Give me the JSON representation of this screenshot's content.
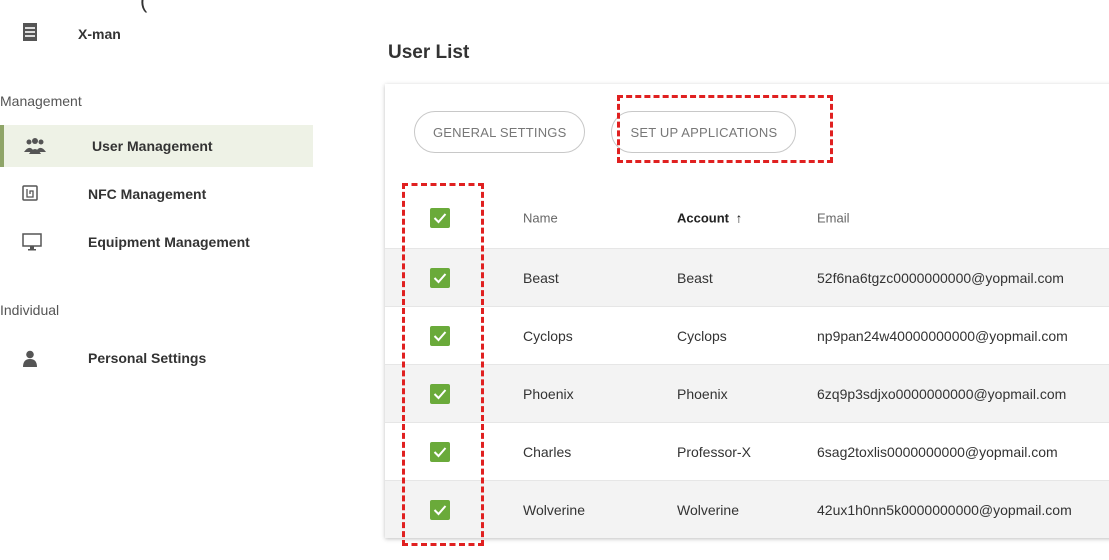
{
  "top_crop_text": "(",
  "sidebar": {
    "brand": "X-man",
    "sections": [
      {
        "title": "Management"
      },
      {
        "title": "Individual"
      }
    ],
    "items": [
      {
        "label": "User Management",
        "icon": "users-icon"
      },
      {
        "label": "NFC Management",
        "icon": "nfc-icon"
      },
      {
        "label": "Equipment Management",
        "icon": "monitor-icon"
      },
      {
        "label": "Personal Settings",
        "icon": "person-icon"
      }
    ]
  },
  "main": {
    "title": "User List",
    "tabs": [
      {
        "label": "GENERAL SETTINGS"
      },
      {
        "label": "SET UP APPLICATIONS"
      }
    ],
    "table": {
      "headers": {
        "name": "Name",
        "account": "Account",
        "email": "Email",
        "sort_arrow": "↑"
      },
      "rows": [
        {
          "name": "Beast",
          "account": "Beast",
          "email": "52f6na6tgzc0000000000@yopmail.com"
        },
        {
          "name": "Cyclops",
          "account": "Cyclops",
          "email": "np9pan24w40000000000@yopmail.com"
        },
        {
          "name": "Phoenix",
          "account": "Phoenix",
          "email": "6zq9p3sdjxo0000000000@yopmail.com"
        },
        {
          "name": "Charles",
          "account": "Professor-X",
          "email": "6sag2toxlis0000000000@yopmail.com"
        },
        {
          "name": "Wolverine",
          "account": "Wolverine",
          "email": "42ux1h0nn5k0000000000@yopmail.com"
        }
      ]
    }
  },
  "colors": {
    "accent": "#6aaa3a",
    "highlight": "#e02020",
    "active_nav_bg": "#eef2e6"
  }
}
